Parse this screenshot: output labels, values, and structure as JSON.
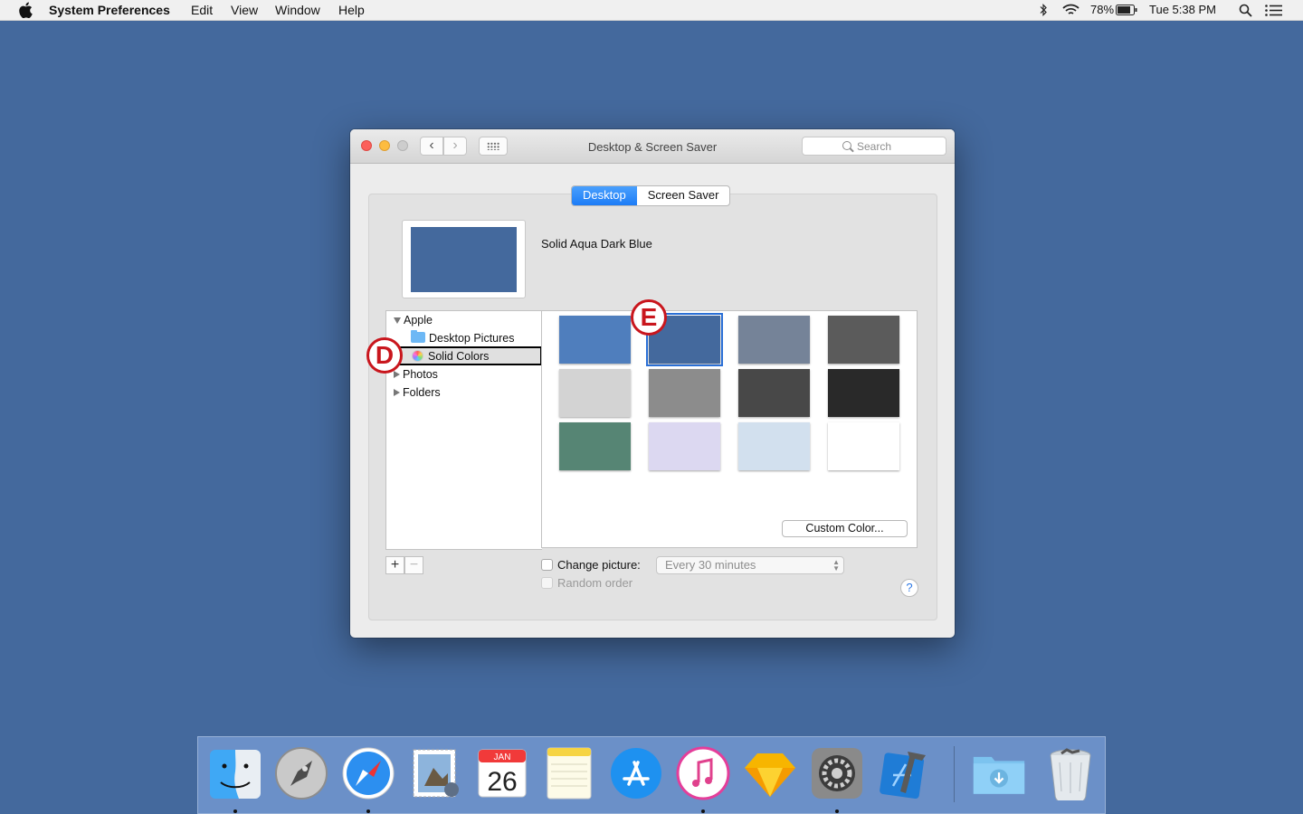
{
  "menubar": {
    "app_name": "System Preferences",
    "items": [
      "Edit",
      "View",
      "Window",
      "Help"
    ],
    "status": {
      "battery": "78%",
      "clock": "Tue 5:38 PM"
    }
  },
  "window": {
    "title": "Desktop & Screen Saver",
    "search_placeholder": "Search",
    "nav": {
      "back": "‹",
      "forward": "›"
    }
  },
  "tabs": [
    {
      "label": "Desktop",
      "active": true
    },
    {
      "label": "Screen Saver",
      "active": false
    }
  ],
  "preview": {
    "name": "Solid Aqua Dark Blue",
    "color": "#44699d"
  },
  "sidebar": {
    "apple": "Apple",
    "desktop_pictures": "Desktop Pictures",
    "solid_colors": "Solid Colors",
    "photos": "Photos",
    "folders": "Folders"
  },
  "swatches": [
    "#4f7ebd",
    "#44699d",
    "#758398",
    "#5b5b5b",
    "#d3d3d3",
    "#8c8c8c",
    "#484848",
    "#292929",
    "#568574",
    "#dcd8f1",
    "#d2e0ee",
    "#ffffff"
  ],
  "selected_swatch": 1,
  "custom_color_label": "Custom Color...",
  "controls": {
    "plus": "+",
    "minus": "−",
    "change_picture_label": "Change picture:",
    "interval": "Every 30 minutes",
    "random_order_label": "Random order",
    "help": "?"
  },
  "callouts": {
    "d": "D",
    "e": "E"
  },
  "dock": {
    "calendar_month": "JAN",
    "calendar_day": "26"
  }
}
